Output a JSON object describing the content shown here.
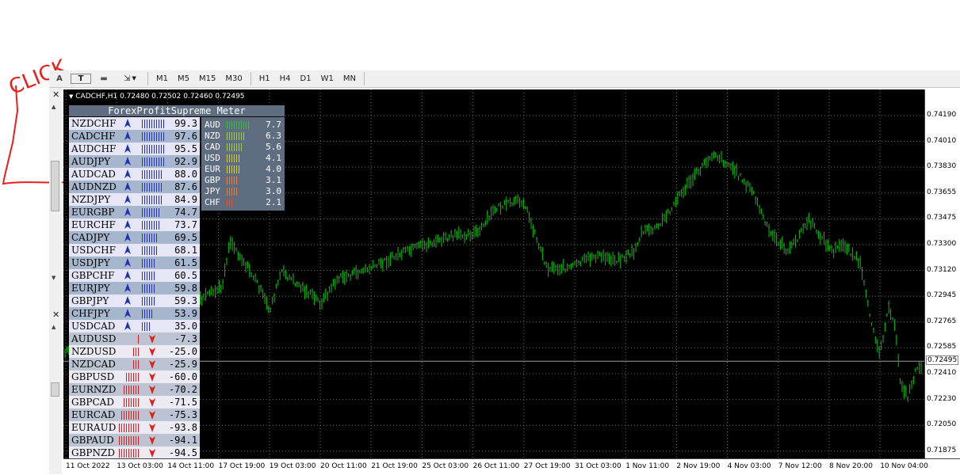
{
  "annotation": {
    "text": "CLICK",
    "color": "#e8201a"
  },
  "toolbar": {
    "icons": [
      {
        "name": "text-icon",
        "glyph": "A"
      },
      {
        "name": "text-label-icon",
        "glyph": "T"
      },
      {
        "name": "rectangle-label-icon",
        "glyph": "▬"
      },
      {
        "name": "arrows-icon",
        "glyph": "⇲"
      }
    ],
    "timeframes": [
      "M1",
      "M5",
      "M15",
      "M30",
      "H1",
      "H4",
      "D1",
      "W1",
      "MN"
    ]
  },
  "chart": {
    "info": "CADCHF,H1  0.72480 0.72502 0.72460 0.72495",
    "current_price": "0.72495",
    "current_price_value": 0.72495,
    "price_ticks": [
      "0.74190",
      "0.74010",
      "0.73830",
      "0.73655",
      "0.73475",
      "0.73300",
      "0.73120",
      "0.72945",
      "0.72765",
      "0.72585",
      "0.72410",
      "0.72230",
      "0.72050",
      "0.71875"
    ],
    "time_ticks": [
      "11 Oct 2022",
      "13 Oct 03:00",
      "14 Oct 11:00",
      "17 Oct 19:00",
      "19 Oct 03:00",
      "20 Oct 11:00",
      "21 Oct 19:00",
      "25 Oct 03:00",
      "26 Oct 11:00",
      "27 Oct 19:00",
      "31 Oct 03:00",
      "1 Nov 11:00",
      "2 Nov 19:00",
      "4 Nov 03:00",
      "7 Nov 12:00",
      "8 Nov 20:00",
      "10 Nov 04:00"
    ],
    "bar_color": "#00c400"
  },
  "meter": {
    "title": "ForexProfitSupreme Meter",
    "pairs": [
      {
        "name": "NZDCHF",
        "value": "99.3",
        "dir": "up",
        "bars": 10
      },
      {
        "name": "CADCHF",
        "value": "97.6",
        "dir": "up",
        "bars": 10
      },
      {
        "name": "AUDCHF",
        "value": "95.5",
        "dir": "up",
        "bars": 10
      },
      {
        "name": "AUDJPY",
        "value": "92.9",
        "dir": "up",
        "bars": 10
      },
      {
        "name": "AUDCAD",
        "value": "88.0",
        "dir": "up",
        "bars": 9
      },
      {
        "name": "AUDNZD",
        "value": "87.6",
        "dir": "up",
        "bars": 9
      },
      {
        "name": "NZDJPY",
        "value": "84.9",
        "dir": "up",
        "bars": 9
      },
      {
        "name": "EURGBP",
        "value": "74.7",
        "dir": "up",
        "bars": 8
      },
      {
        "name": "EURCHF",
        "value": "73.7",
        "dir": "up",
        "bars": 8
      },
      {
        "name": "CADJPY",
        "value": "69.5",
        "dir": "up",
        "bars": 7
      },
      {
        "name": "USDCHF",
        "value": "68.1",
        "dir": "up",
        "bars": 7
      },
      {
        "name": "USDJPY",
        "value": "61.5",
        "dir": "up",
        "bars": 6
      },
      {
        "name": "GBPCHF",
        "value": "60.5",
        "dir": "up",
        "bars": 6
      },
      {
        "name": "EURJPY",
        "value": "59.8",
        "dir": "up",
        "bars": 6
      },
      {
        "name": "GBPJPY",
        "value": "59.3",
        "dir": "up",
        "bars": 6
      },
      {
        "name": "CHFJPY",
        "value": "53.9",
        "dir": "up",
        "bars": 5
      },
      {
        "name": "USDCAD",
        "value": "35.0",
        "dir": "up",
        "bars": 4
      },
      {
        "name": "AUDUSD",
        "value": "-7.3",
        "dir": "down",
        "bars": 1
      },
      {
        "name": "NZDUSD",
        "value": "-25.0",
        "dir": "down",
        "bars": 3
      },
      {
        "name": "NZDCAD",
        "value": "-25.9",
        "dir": "down",
        "bars": 3
      },
      {
        "name": "GBPUSD",
        "value": "-60.0",
        "dir": "down",
        "bars": 6
      },
      {
        "name": "EURNZD",
        "value": "-70.2",
        "dir": "down",
        "bars": 7
      },
      {
        "name": "GBPCAD",
        "value": "-71.5",
        "dir": "down",
        "bars": 7
      },
      {
        "name": "EURCAD",
        "value": "-75.3",
        "dir": "down",
        "bars": 8
      },
      {
        "name": "EURAUD",
        "value": "-93.8",
        "dir": "down",
        "bars": 9
      },
      {
        "name": "GBPAUD",
        "value": "-94.1",
        "dir": "down",
        "bars": 9
      },
      {
        "name": "GBPNZD",
        "value": "-94.5",
        "dir": "down",
        "bars": 9
      }
    ],
    "currencies": [
      {
        "name": "AUD",
        "value": "7.7",
        "color": "#30c030",
        "bars": 10
      },
      {
        "name": "NZD",
        "value": "6.3",
        "color": "#9fd040",
        "bars": 8
      },
      {
        "name": "CAD",
        "value": "5.6",
        "color": "#a8cc40",
        "bars": 7
      },
      {
        "name": "USD",
        "value": "4.1",
        "color": "#d8d020",
        "bars": 6
      },
      {
        "name": "EUR",
        "value": "4.0",
        "color": "#e0d020",
        "bars": 6
      },
      {
        "name": "GBP",
        "value": "3.1",
        "color": "#f07a30",
        "bars": 5
      },
      {
        "name": "JPY",
        "value": "3.0",
        "color": "#f07a30",
        "bars": 5
      },
      {
        "name": "CHF",
        "value": "2.1",
        "color": "#f04a20",
        "bars": 3
      }
    ]
  }
}
